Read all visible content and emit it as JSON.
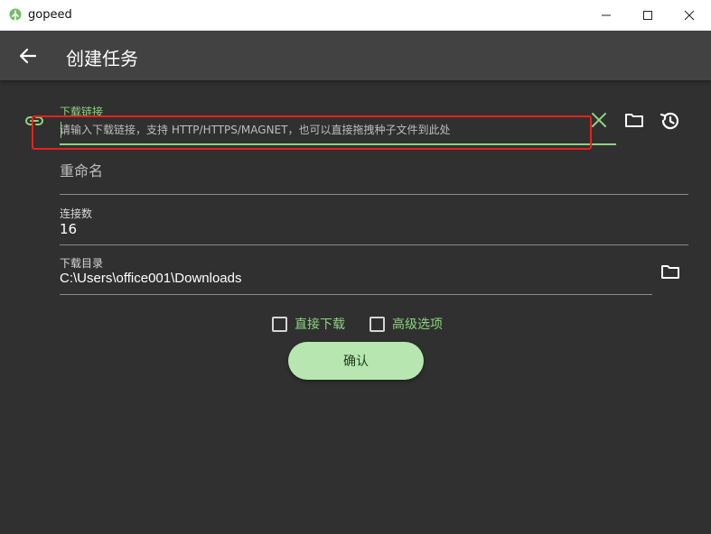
{
  "window": {
    "title": "gopeed",
    "logo_icon": "gopeed-logo-icon"
  },
  "appbar": {
    "title": "创建任务",
    "back_icon": "arrow-left-icon"
  },
  "form": {
    "url": {
      "label": "下载链接",
      "placeholder": "请输入下载链接，支持 HTTP/HTTPS/MAGNET，也可以直接拖拽种子文件到此处",
      "value": ""
    },
    "rename": {
      "placeholder": "重命名",
      "value": ""
    },
    "connections": {
      "label": "连接数",
      "value": "16"
    },
    "directory": {
      "label": "下载目录",
      "value": "C:\\Users\\office001\\Downloads"
    },
    "options": {
      "direct_download": "直接下载",
      "advanced_options": "高级选项"
    },
    "confirm_label": "确认"
  },
  "colors": {
    "accent": "#8bd47f",
    "background": "#303030",
    "appbar": "#424242",
    "button": "#b7e6b0",
    "highlight_box": "#e8211f"
  }
}
